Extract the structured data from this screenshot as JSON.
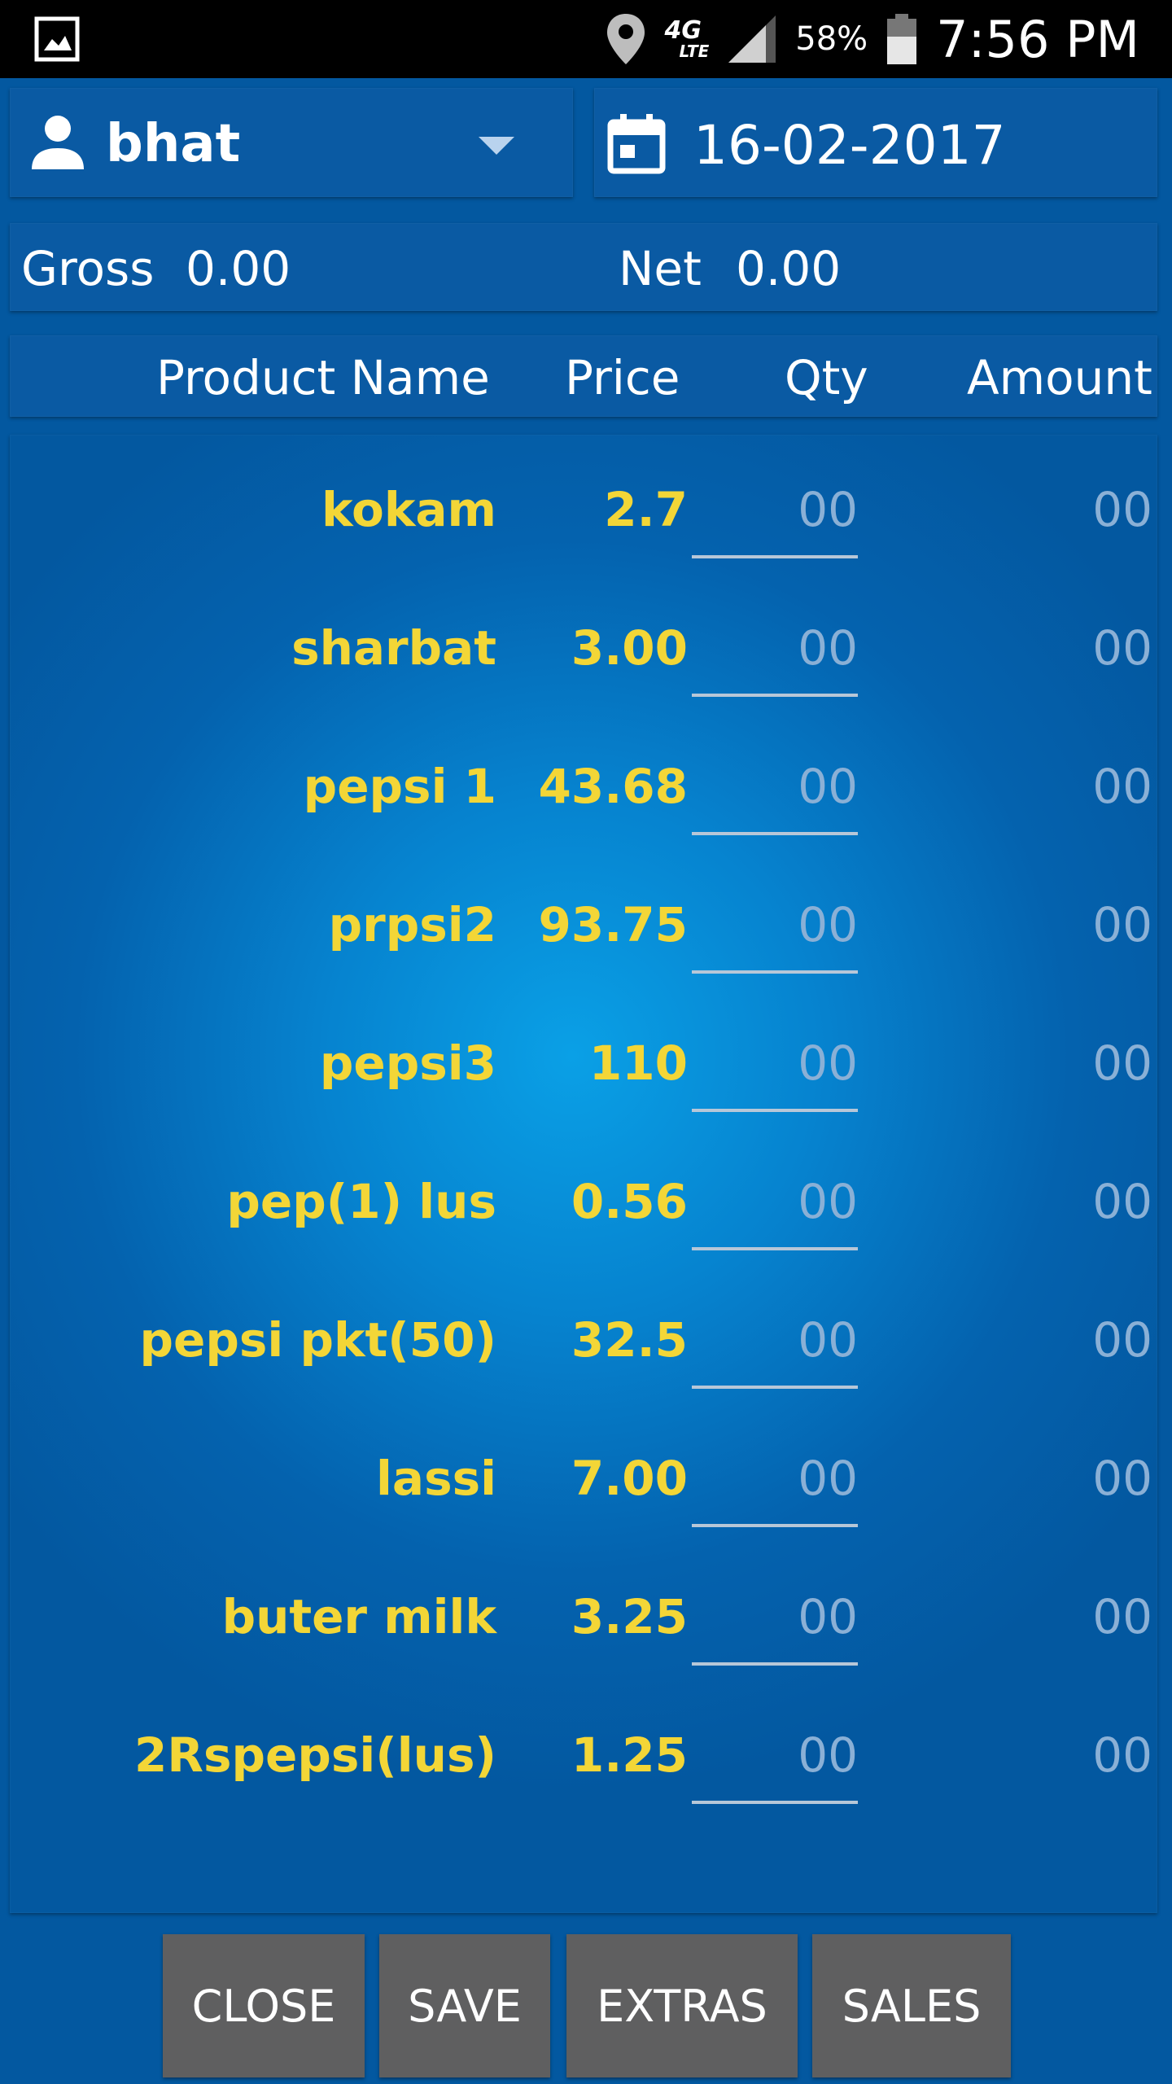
{
  "status_bar": {
    "battery_percent": "58%",
    "time": "7:56 PM",
    "network": "4G",
    "network_sub": "LTE"
  },
  "customer": {
    "name": "bhat"
  },
  "date": {
    "value": "16-02-2017"
  },
  "totals": {
    "gross_label": "Gross",
    "gross_value": "0.00",
    "net_label": "Net",
    "net_value": "0.00"
  },
  "table": {
    "headers": {
      "product_name": "Product Name",
      "price": "Price",
      "qty": "Qty",
      "amount": "Amount"
    },
    "rows": [
      {
        "name": "kokam",
        "price": "2.7",
        "qty": "00",
        "amount": "00"
      },
      {
        "name": "sharbat",
        "price": "3.00",
        "qty": "00",
        "amount": "00"
      },
      {
        "name": "pepsi 1",
        "price": "43.68",
        "qty": "00",
        "amount": "00"
      },
      {
        "name": "prpsi2",
        "price": "93.75",
        "qty": "00",
        "amount": "00"
      },
      {
        "name": "pepsi3",
        "price": "110",
        "qty": "00",
        "amount": "00"
      },
      {
        "name": "pep(1) lus",
        "price": "0.56",
        "qty": "00",
        "amount": "00"
      },
      {
        "name": "pepsi pkt(50)",
        "price": "32.5",
        "qty": "00",
        "amount": "00"
      },
      {
        "name": "lassi",
        "price": "7.00",
        "qty": "00",
        "amount": "00"
      },
      {
        "name": "buter milk",
        "price": "3.25",
        "qty": "00",
        "amount": "00"
      },
      {
        "name": "2Rspepsi(lus)",
        "price": "1.25",
        "qty": "00",
        "amount": "00"
      }
    ]
  },
  "buttons": {
    "close": "CLOSE",
    "save": "SAVE",
    "extras": "EXTRAS",
    "sales": "SALES"
  },
  "colors": {
    "background": "#0358a0",
    "accent_text": "#f3d637",
    "muted_value": "#8ab0d6",
    "button": "#5f5f60"
  }
}
